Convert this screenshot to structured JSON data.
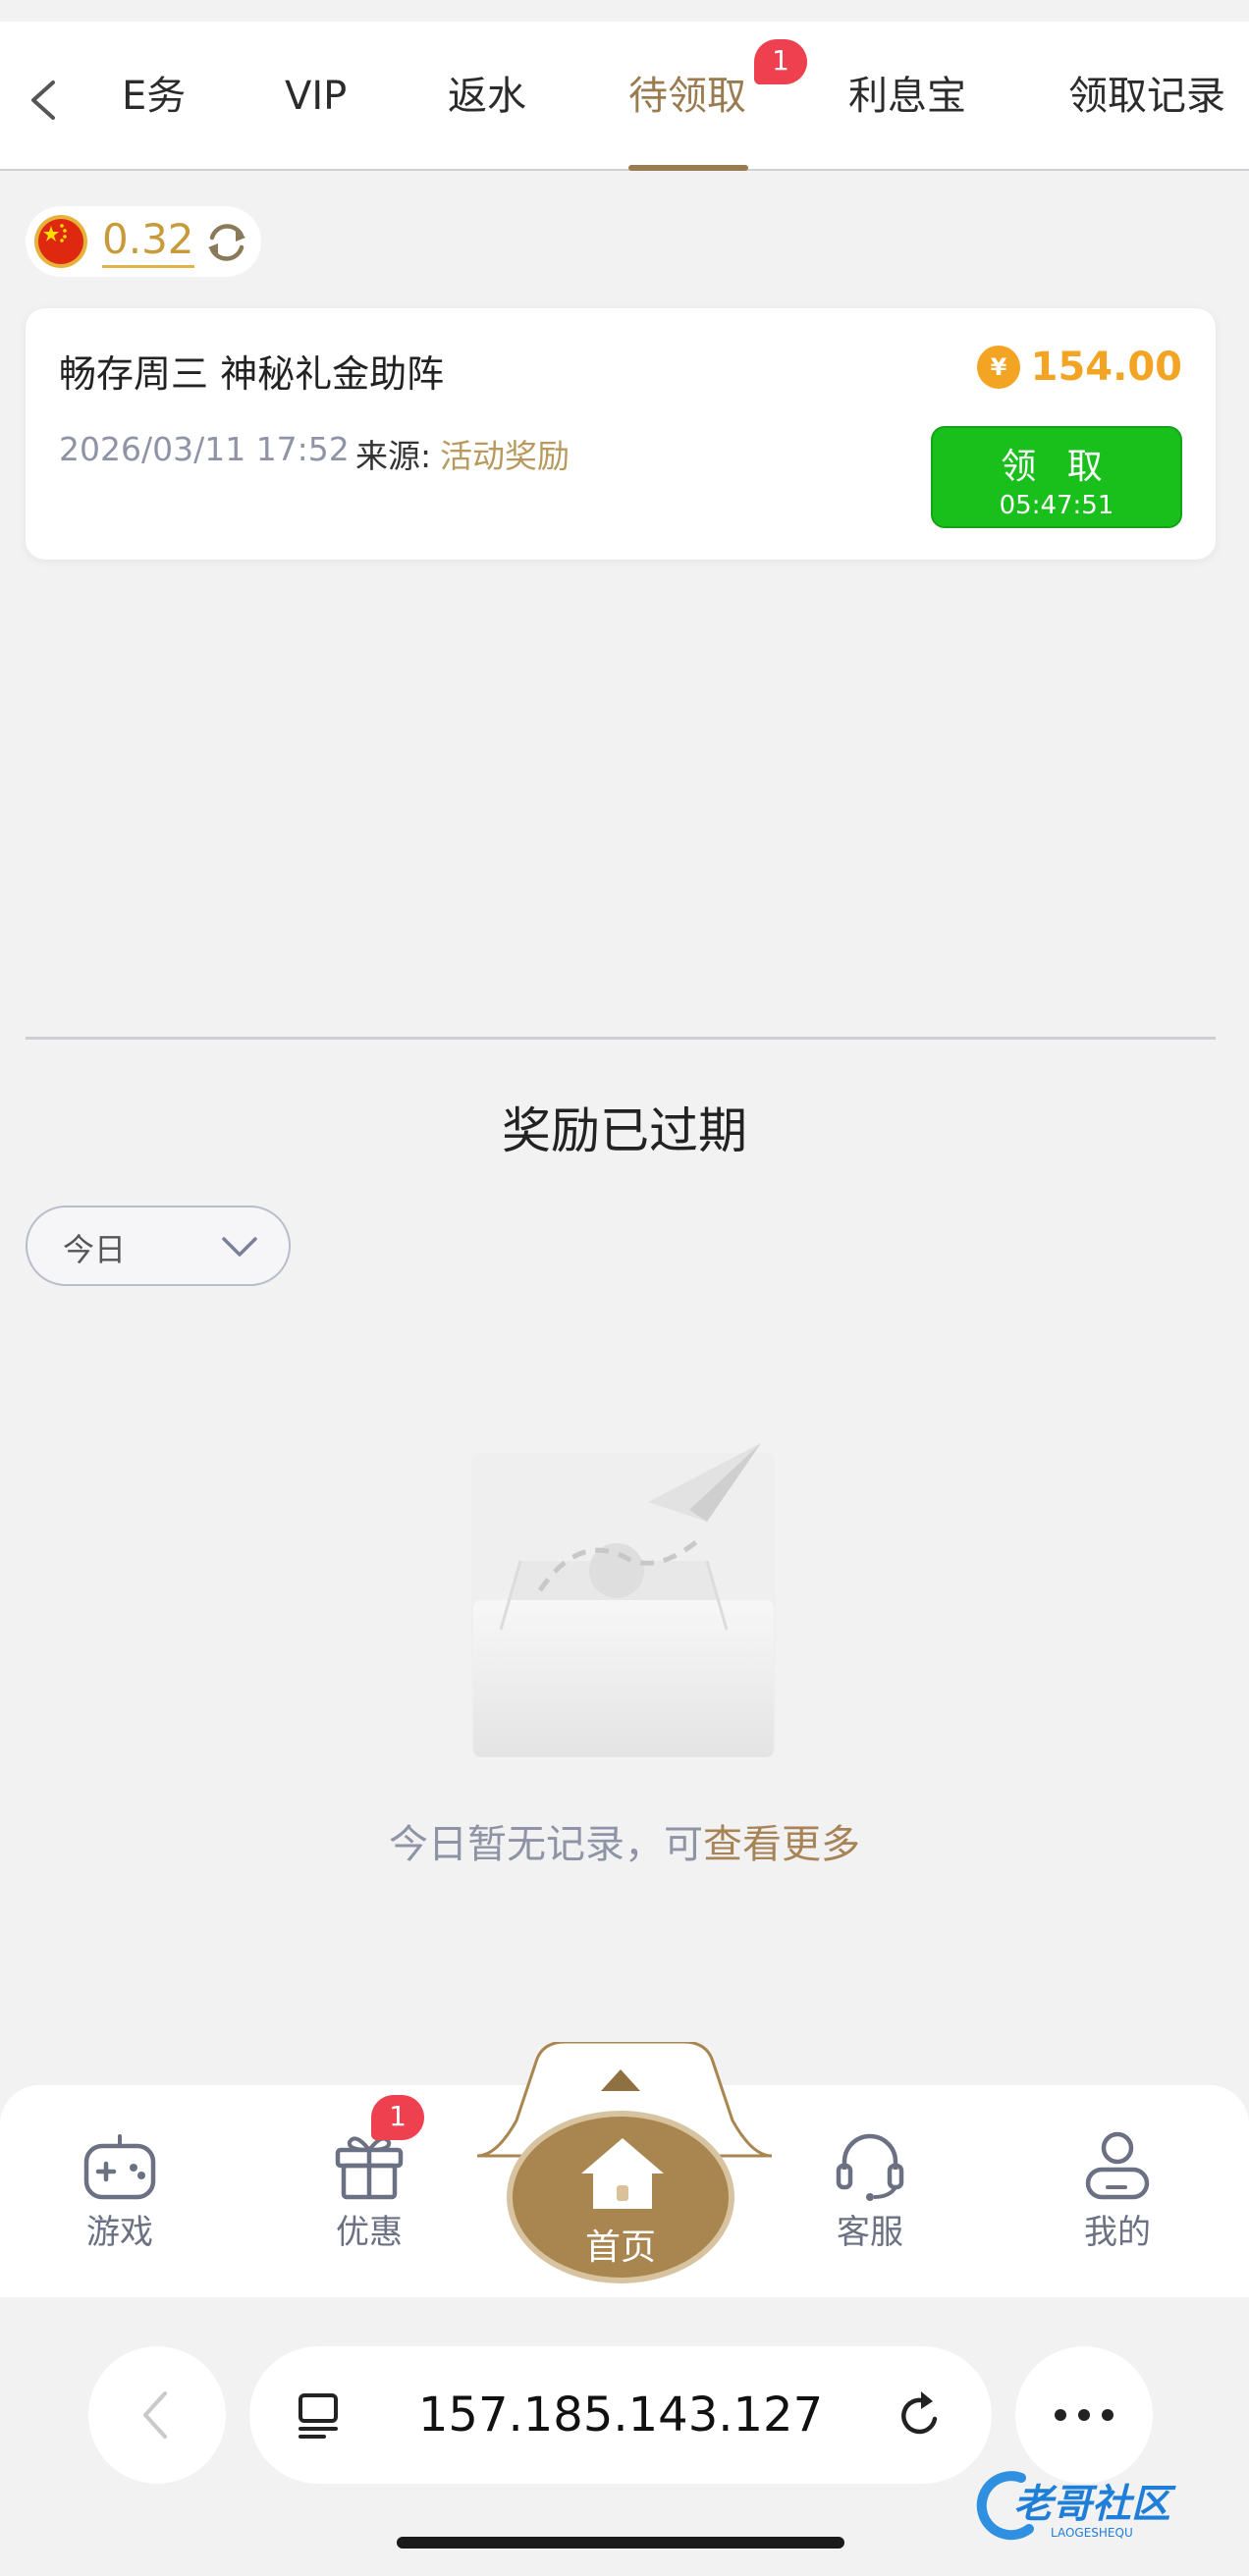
{
  "tabs": [
    {
      "label": "E务",
      "active": false
    },
    {
      "label": "VIP",
      "active": false
    },
    {
      "label": "返水",
      "active": false
    },
    {
      "label": "待领取",
      "active": true,
      "badge": "1"
    },
    {
      "label": "利息宝",
      "active": false
    },
    {
      "label": "领取记录",
      "active": false
    }
  ],
  "balance": {
    "value": "0.32",
    "flag": "china-flag-icon"
  },
  "reward": {
    "title": "畅存周三 神秘礼金助阵",
    "amount": "154.00",
    "datetime": "2026/03/11 17:52",
    "source_label": "来源:",
    "source": "活动奖励",
    "claim_label": "领 取",
    "countdown": "05:47:51"
  },
  "expired": {
    "title": "奖励已过期",
    "filter": "今日",
    "empty_text": "今日暂无记录，可",
    "empty_link": "查看更多"
  },
  "bottom_nav": [
    {
      "label": "游戏",
      "icon": "gamepad-icon"
    },
    {
      "label": "优惠",
      "icon": "gift-icon",
      "badge": "1"
    },
    {
      "label": "首页",
      "icon": "home-icon"
    },
    {
      "label": "客服",
      "icon": "headset-icon"
    },
    {
      "label": "我的",
      "icon": "user-icon"
    }
  ],
  "browser": {
    "url": "157.185.143.127"
  },
  "watermark": "老哥社区",
  "colors": {
    "accent": "#9a7b4f",
    "claim_green": "#19c01c",
    "amount_orange": "#f2a422",
    "badge_red": "#ef4050"
  }
}
